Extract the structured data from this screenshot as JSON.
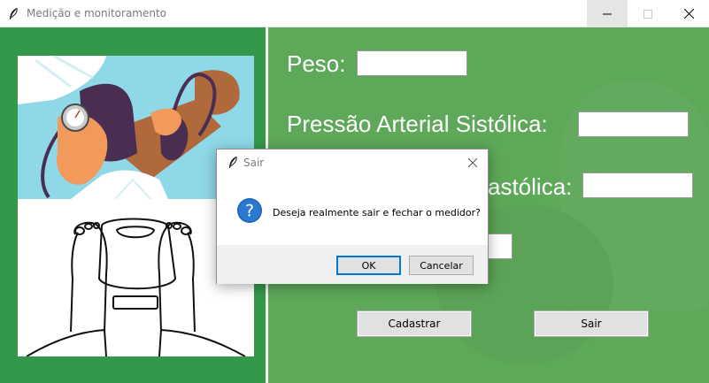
{
  "window": {
    "title": "Medição e monitoramento",
    "icon": "feather-icon"
  },
  "form": {
    "peso_label": "Peso:",
    "pas_label": "Pressão Arterial Sistólica:",
    "pad_label_visible": "astólica:",
    "peso_value": "",
    "pas_value": "",
    "pad_value": "",
    "extra_value": ""
  },
  "buttons": {
    "cadastrar": "Cadastrar",
    "sair": "Sair"
  },
  "dialog": {
    "title": "Sair",
    "message": "Deseja realmente sair e fechar o medidor?",
    "ok_label": "OK",
    "cancel_label": "Cancelar",
    "icon": "question-icon"
  },
  "colors": {
    "left_panel": "#34984a",
    "right_panel": "#5ea85a",
    "accent": "#0078d7"
  }
}
